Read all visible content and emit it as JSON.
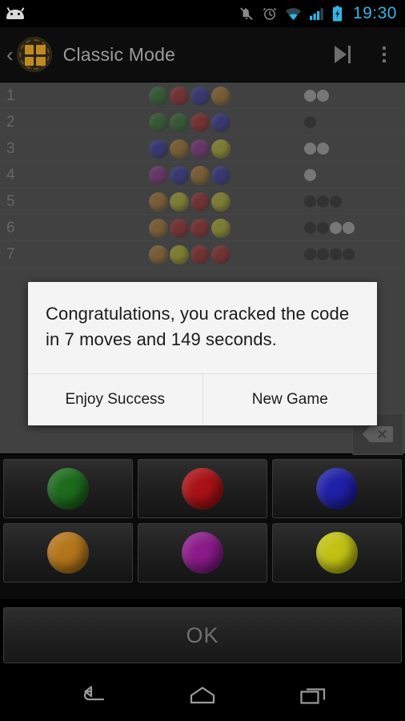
{
  "status_bar": {
    "time": "19:30",
    "icons": [
      "android-mascot-icon",
      "ringer-muted-icon",
      "alarm-clock-icon",
      "wifi-icon",
      "cellular-signal-icon",
      "battery-charging-icon"
    ]
  },
  "action_bar": {
    "back_chevron": "‹",
    "app_icon": "grid-app-icon",
    "title": "Classic Mode",
    "actions": [
      {
        "name": "skip-to-end-button",
        "icon": "skip-next-icon"
      },
      {
        "name": "overflow-menu-button",
        "icon": "three-dots-icon"
      }
    ]
  },
  "colors": {
    "green": "#1d6b1d",
    "red": "#a81217",
    "blue": "#2020a8",
    "orange": "#b5761b",
    "purple": "#8a1b8a",
    "yellow": "#c2c213",
    "peg_black": "#121212",
    "peg_white": "#b5b5b5",
    "accent": "#33b5e5",
    "board_bg": "#353535",
    "dialog_bg": "#f4f4f4"
  },
  "board": {
    "rows": [
      {
        "number": "1",
        "guess": [
          "green",
          "red",
          "blue",
          "orange"
        ],
        "feedback": [
          "white",
          "white"
        ]
      },
      {
        "number": "2",
        "guess": [
          "green",
          "green",
          "red",
          "blue"
        ],
        "feedback": [
          "black"
        ]
      },
      {
        "number": "3",
        "guess": [
          "blue",
          "orange",
          "purple",
          "yellow"
        ],
        "feedback": [
          "white",
          "white"
        ]
      },
      {
        "number": "4",
        "guess": [
          "purple",
          "blue",
          "orange",
          "blue"
        ],
        "feedback": [
          "white"
        ]
      },
      {
        "number": "5",
        "guess": [
          "orange",
          "yellow",
          "red",
          "yellow"
        ],
        "feedback": [
          "black",
          "black",
          "black"
        ]
      },
      {
        "number": "6",
        "guess": [
          "orange",
          "red",
          "red",
          "yellow"
        ],
        "feedback": [
          "black",
          "black",
          "white",
          "white"
        ]
      },
      {
        "number": "7",
        "guess": [
          "orange",
          "yellow",
          "red",
          "red"
        ],
        "feedback": [
          "black",
          "black",
          "black",
          "black"
        ]
      }
    ]
  },
  "input": {
    "backspace_icon": "backspace-delete-icon",
    "palette_rows": [
      [
        "green",
        "red",
        "blue"
      ],
      [
        "orange",
        "purple",
        "yellow"
      ]
    ],
    "ok_label": "OK"
  },
  "dialog": {
    "message": "Congratulations, you cracked the code in 7 moves and 149 seconds.",
    "buttons": [
      {
        "name": "enjoy-success-button",
        "label": "Enjoy Success"
      },
      {
        "name": "new-game-button",
        "label": "New Game"
      }
    ]
  },
  "nav_bar": {
    "items": [
      {
        "name": "nav-back-button",
        "icon": "back-arrow-icon"
      },
      {
        "name": "nav-home-button",
        "icon": "home-icon"
      },
      {
        "name": "nav-recents-button",
        "icon": "recents-icon"
      }
    ]
  }
}
